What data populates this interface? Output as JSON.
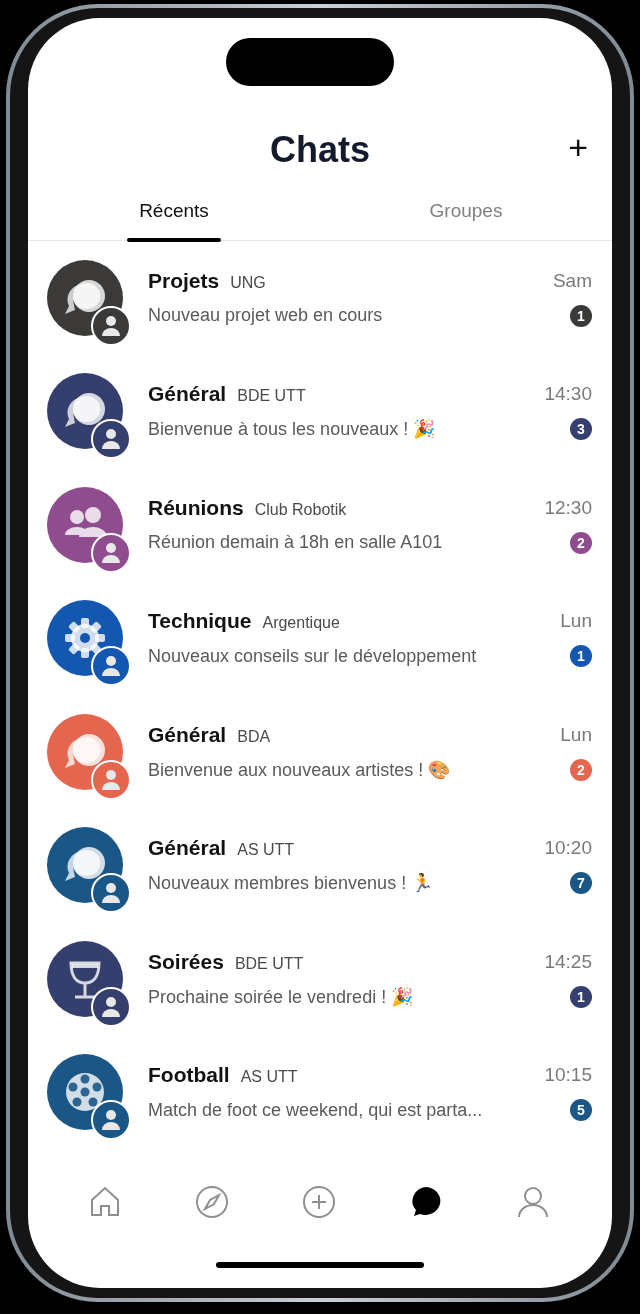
{
  "header": {
    "title": "Chats",
    "add_button": "+"
  },
  "tabs": [
    {
      "label": "Récents",
      "selected": true
    },
    {
      "label": "Groupes",
      "selected": false
    }
  ],
  "chats": [
    {
      "name": "Projets",
      "group": "UNG",
      "time": "Sam",
      "message": "Nouveau projet web en cours",
      "unread": "1",
      "color": "#3b3a38",
      "kind": "chat"
    },
    {
      "name": "Général",
      "group": "BDE UTT",
      "time": "14:30",
      "message": "Bienvenue à tous les nouveaux ! 🎉",
      "unread": "3",
      "color": "#353f6e",
      "kind": "chat"
    },
    {
      "name": "Réunions",
      "group": "Club Robotik",
      "time": "12:30",
      "message": "Réunion demain à 18h en salle A101",
      "unread": "2",
      "color": "#8f4c8e",
      "kind": "people"
    },
    {
      "name": "Technique",
      "group": "Argentique",
      "time": "Lun",
      "message": "Nouveaux conseils sur le développement",
      "unread": "1",
      "color": "#1457b0",
      "kind": "gear"
    },
    {
      "name": "Général",
      "group": "BDA",
      "time": "Lun",
      "message": "Bienvenue aux nouveaux artistes ! 🎨",
      "unread": "2",
      "color": "#e5664f",
      "kind": "chat"
    },
    {
      "name": "Général",
      "group": "AS UTT",
      "time": "10:20",
      "message": "Nouveaux membres bienvenus ! 🏃",
      "unread": "7",
      "color": "#1b5786",
      "kind": "chat"
    },
    {
      "name": "Soirées",
      "group": "BDE UTT",
      "time": "14:25",
      "message": "Prochaine soirée le vendredi ! 🎉",
      "unread": "1",
      "color": "#353f6e",
      "kind": "glass"
    },
    {
      "name": "Football",
      "group": "AS UTT",
      "time": "10:15",
      "message": "Match de foot ce weekend, qui est parta...",
      "unread": "5",
      "color": "#1b5786",
      "kind": "ball"
    }
  ],
  "nav": [
    {
      "kind": "home",
      "selected": false
    },
    {
      "kind": "compass",
      "selected": false
    },
    {
      "kind": "plus",
      "selected": false
    },
    {
      "kind": "chat",
      "selected": true
    },
    {
      "kind": "user",
      "selected": false
    }
  ]
}
